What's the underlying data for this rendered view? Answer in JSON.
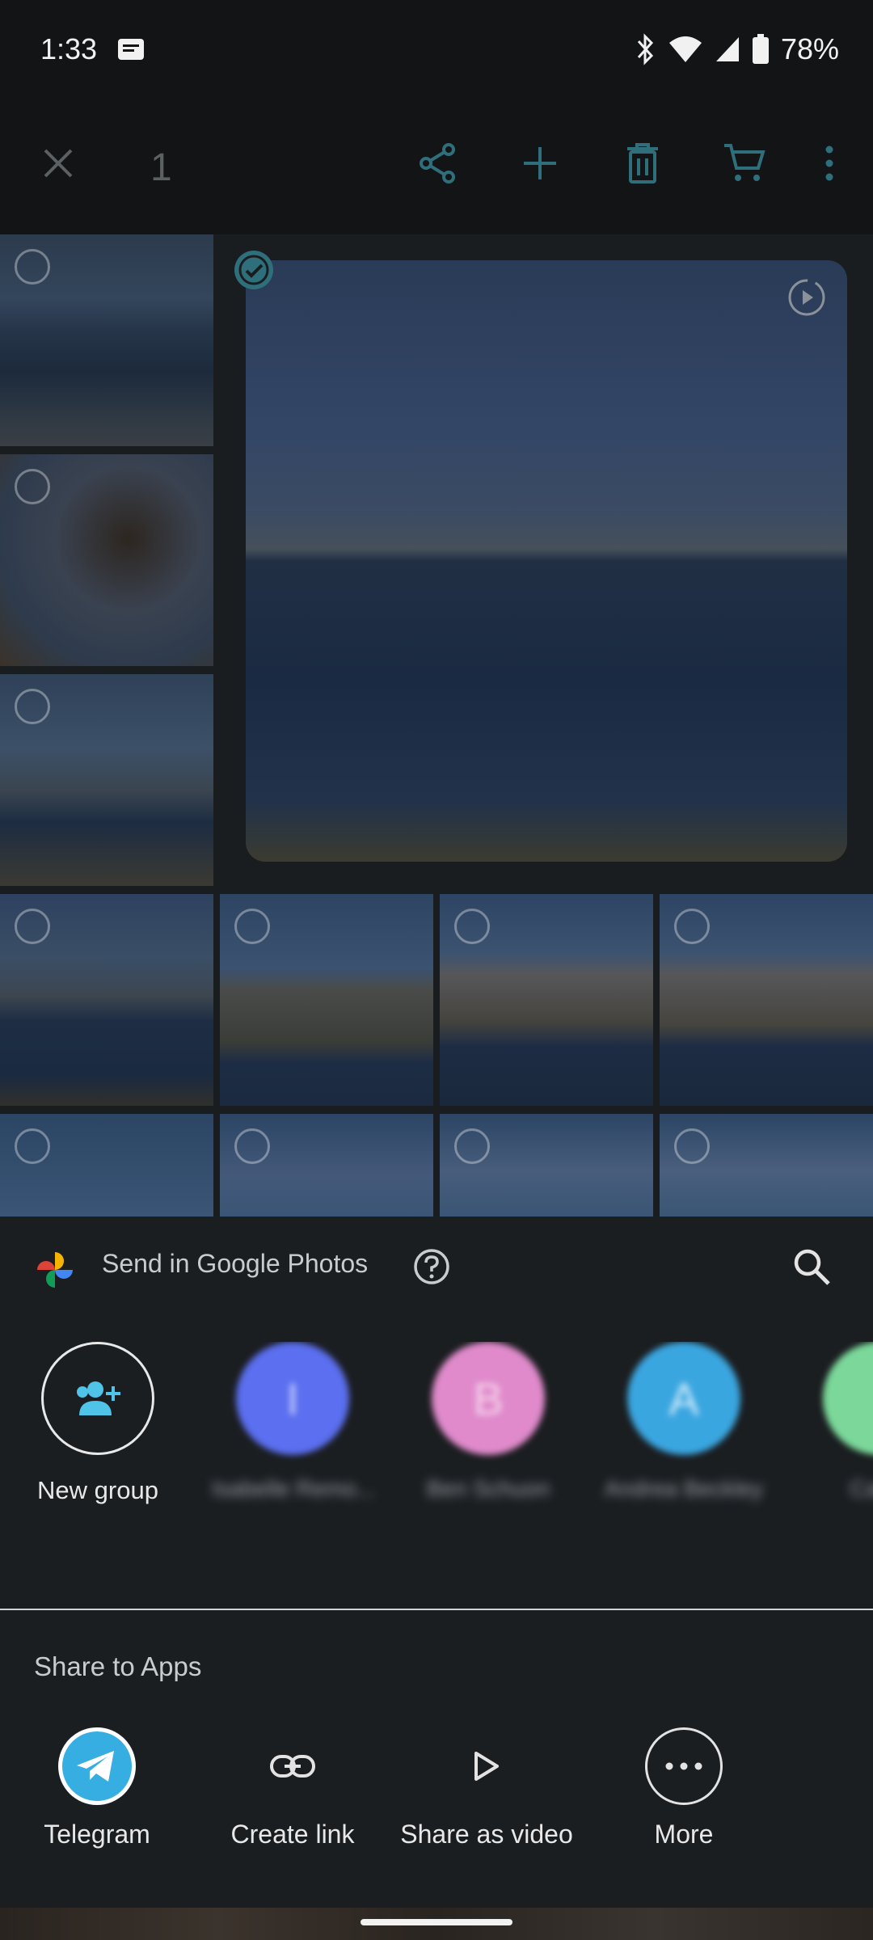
{
  "status": {
    "time": "1:33",
    "battery": "78%",
    "icons": [
      "message-icon",
      "bluetooth-icon",
      "wifi-icon",
      "signal-icon",
      "battery-icon"
    ]
  },
  "toolbar": {
    "selected_count": "1",
    "icons": [
      "close-icon",
      "share-icon",
      "add-icon",
      "delete-icon",
      "cart-icon",
      "more-vert-icon"
    ],
    "accent": "#2f6f7c"
  },
  "sheet": {
    "send_title": "Send in Google Photos",
    "contacts": [
      {
        "label": "New group",
        "blurred": false
      },
      {
        "label": "Isabelle Remo...",
        "blurred": true,
        "initial": "I",
        "color": "#5b6ff0"
      },
      {
        "label": "Ben Schuon",
        "blurred": true,
        "initial": "B",
        "color": "#e08acb"
      },
      {
        "label": "Andrea Beckley",
        "blurred": true,
        "initial": "A",
        "color": "#3aa6e0"
      },
      {
        "label": "Caleb",
        "blurred": true,
        "initial": "",
        "color": "#7bd89a"
      }
    ],
    "apps_title": "Share to Apps",
    "apps": [
      {
        "label": "Telegram",
        "icon": "telegram-icon"
      },
      {
        "label": "Create link",
        "icon": "link-icon"
      },
      {
        "label": "Share as video",
        "icon": "play-icon"
      },
      {
        "label": "More",
        "icon": "more-horiz-icon"
      }
    ]
  }
}
